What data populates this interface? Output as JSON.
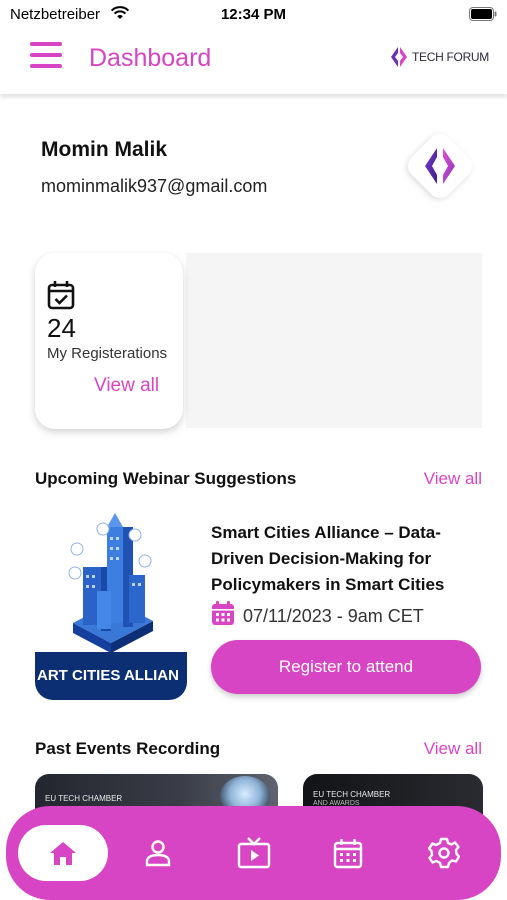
{
  "status_bar": {
    "carrier": "Netzbetreiber",
    "time": "12:34 PM"
  },
  "header": {
    "title": "Dashboard",
    "brand": "TECH FORUM"
  },
  "profile": {
    "name": "Momin Malik",
    "email": "mominmalik937@gmail.com"
  },
  "stats": {
    "registrations_count": "24",
    "registrations_label": "My Registerations",
    "view_all": "View all"
  },
  "webinars": {
    "section_title": "Upcoming Webinar Suggestions",
    "view_all": "View all",
    "item": {
      "thumb_banner": "ART CITIES ALLIAN",
      "title": "Smart Cities Alliance – Data-Driven Decision-Making for Policymakers in Smart Cities",
      "date": "07/11/2023 - 9am CET",
      "cta": "Register to attend"
    }
  },
  "recordings": {
    "section_title": "Past Events Recording",
    "view_all": "View all",
    "items": [
      {
        "label": "EU TECH CHAMBER"
      },
      {
        "label": "EU TECH CHAMBER",
        "sub": "AND AWARDS"
      }
    ]
  },
  "bottom_nav": {
    "items": [
      {
        "icon": "home-icon"
      },
      {
        "icon": "profile-icon"
      },
      {
        "icon": "tv-icon"
      },
      {
        "icon": "calendar-icon"
      },
      {
        "icon": "settings-icon"
      }
    ]
  },
  "colors": {
    "accent": "#d845c4",
    "banner": "#0c2f73"
  }
}
